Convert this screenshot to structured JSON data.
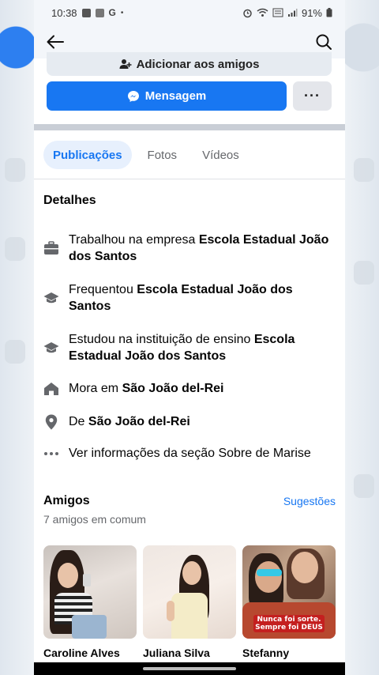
{
  "status": {
    "time": "10:38",
    "notif_g": "G",
    "notif_dot": "•",
    "battery": "91%"
  },
  "header": {
    "add_friends_label": "Adicionar aos amigos",
    "message_label": "Mensagem",
    "more_label": "···"
  },
  "tabs": [
    {
      "label": "Publicações",
      "active": true
    },
    {
      "label": "Fotos",
      "active": false
    },
    {
      "label": "Vídeos",
      "active": false
    }
  ],
  "details": {
    "title": "Detalhes",
    "items": [
      {
        "icon": "briefcase-icon",
        "prefix": "Trabalhou na empresa ",
        "bold": "Escola Estadual João dos Santos"
      },
      {
        "icon": "graduation-cap-icon",
        "prefix": "Frequentou ",
        "bold": "Escola Estadual João dos Santos"
      },
      {
        "icon": "graduation-cap-icon",
        "prefix": "Estudou na instituição de ensino ",
        "bold": "Escola Estadual João dos Santos"
      },
      {
        "icon": "home-icon",
        "prefix": "Mora em ",
        "bold": "São João del-Rei"
      },
      {
        "icon": "location-pin-icon",
        "prefix": "De ",
        "bold": "São João del-Rei"
      },
      {
        "icon": "more-dots-icon",
        "prefix": "Ver informações da seção Sobre de Marise",
        "bold": ""
      }
    ]
  },
  "friends": {
    "title": "Amigos",
    "suggestions_label": "Sugestões",
    "mutual_count": "7 amigos em comum",
    "list": [
      {
        "name": "Caroline Alves"
      },
      {
        "name": "Juliana Silva"
      },
      {
        "name": "Stefanny",
        "banner_text": "Nunca foi sorte. Sempre foi DEUS"
      }
    ]
  },
  "colors": {
    "accent": "#1877f2",
    "tab_active_bg": "#e7f0fd",
    "text_primary": "#050505",
    "text_secondary": "#65676b"
  }
}
